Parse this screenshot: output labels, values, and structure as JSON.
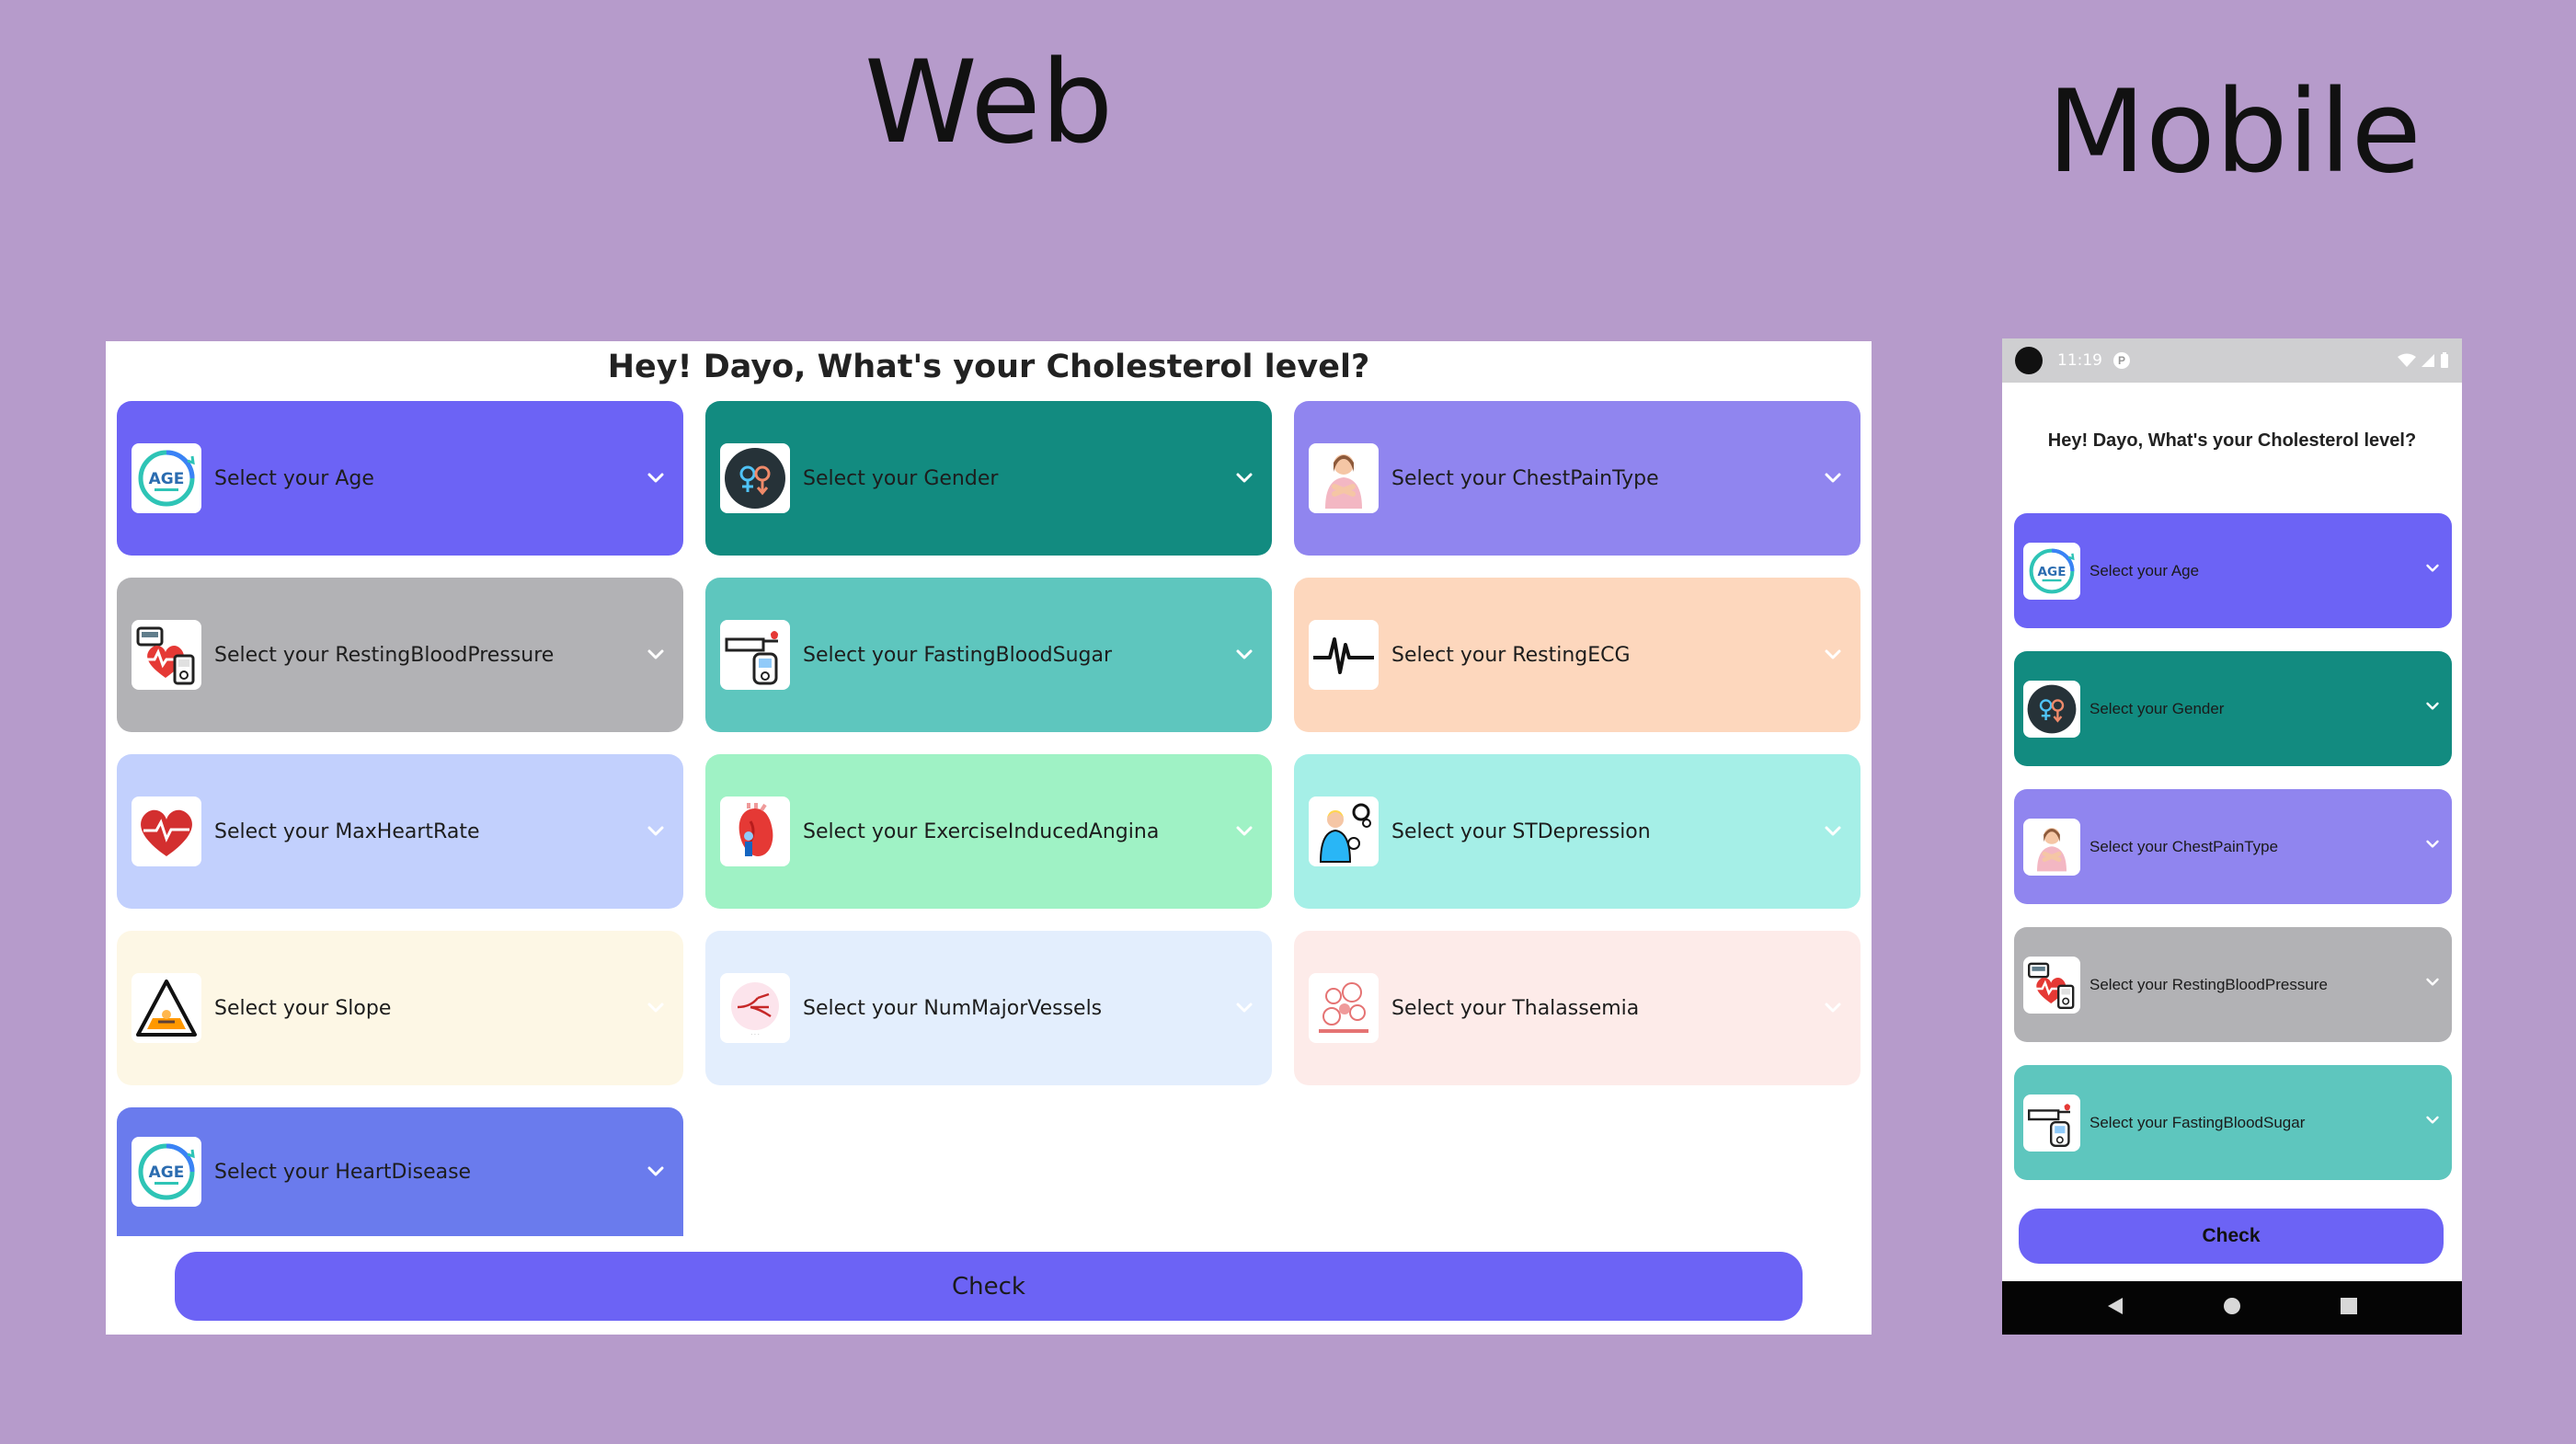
{
  "headings": {
    "web": "Web",
    "mobile": "Mobile"
  },
  "web": {
    "title": "Hey! Dayo, What's your Cholesterol level?",
    "cards": [
      {
        "label": "Select your Age",
        "icon": "age-icon",
        "color": "#6c63f5"
      },
      {
        "label": "Select your Gender",
        "icon": "gender-icon",
        "color": "#128b80"
      },
      {
        "label": "Select your ChestPainType",
        "icon": "chest-pain-icon",
        "color": "#9085ef"
      },
      {
        "label": "Select your RestingBloodPressure",
        "icon": "blood-pressure-icon",
        "color": "#b2b2b5"
      },
      {
        "label": "Select your FastingBloodSugar",
        "icon": "blood-sugar-icon",
        "color": "#5ec6be"
      },
      {
        "label": "Select your RestingECG",
        "icon": "ecg-icon",
        "color": "#fdd7bd"
      },
      {
        "label": "Select your MaxHeartRate",
        "icon": "heart-rate-icon",
        "color": "#c2d0fd"
      },
      {
        "label": "Select your ExerciseInducedAngina",
        "icon": "angina-icon",
        "color": "#9ff2c5"
      },
      {
        "label": "Select your STDepression",
        "icon": "st-depression-icon",
        "color": "#a5efe7"
      },
      {
        "label": "Select your Slope",
        "icon": "slope-icon",
        "color": "#fdf7e5"
      },
      {
        "label": "Select your NumMajorVessels",
        "icon": "vessels-icon",
        "color": "#e3eefd"
      },
      {
        "label": "Select your Thalassemia",
        "icon": "thalassemia-icon",
        "color": "#fdebe9"
      },
      {
        "label": "Select your HeartDisease",
        "icon": "age-icon",
        "color": "#6a7bed"
      }
    ],
    "check_label": "Check"
  },
  "mobile": {
    "status_time": "11:19",
    "status_p": "P",
    "title": "Hey! Dayo, What's your Cholesterol level?",
    "cards": [
      {
        "label": "Select your Age",
        "icon": "age-icon",
        "color": "#6c63f5"
      },
      {
        "label": "Select your Gender",
        "icon": "gender-icon",
        "color": "#128b80"
      },
      {
        "label": "Select your ChestPainType",
        "icon": "chest-pain-icon",
        "color": "#9085ef"
      },
      {
        "label": "Select your RestingBloodPressure",
        "icon": "blood-pressure-icon",
        "color": "#b2b2b5"
      },
      {
        "label": "Select your FastingBloodSugar",
        "icon": "blood-sugar-icon",
        "color": "#5ec6be"
      }
    ],
    "check_label": "Check",
    "nav": [
      "back-icon",
      "home-icon",
      "recents-icon"
    ]
  }
}
